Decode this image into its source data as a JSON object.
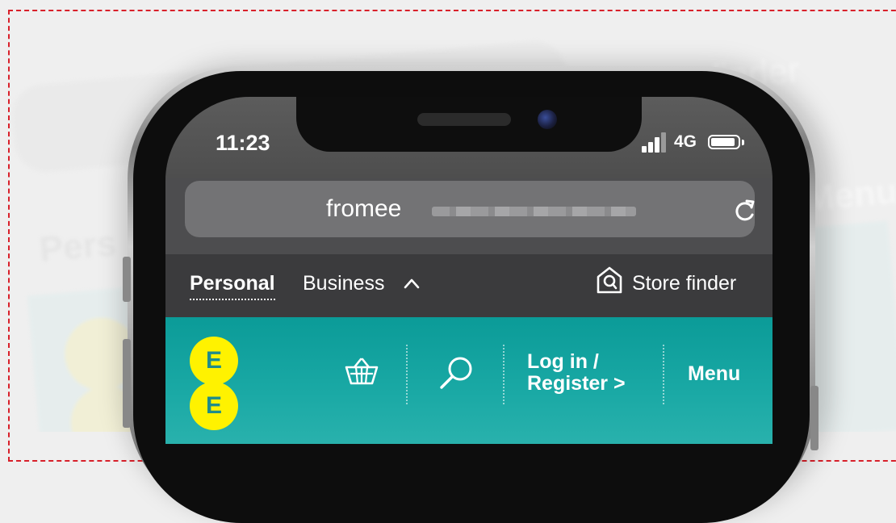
{
  "background": {
    "echo_url": "fromee",
    "echo_store": "Store finder",
    "echo_personal": "Pers",
    "echo_menu": "Menu"
  },
  "status_bar": {
    "time": "11:23",
    "network": "4G",
    "battery_level": 0.9
  },
  "browser": {
    "url_visible": "fromee",
    "reload_icon": "reload-icon"
  },
  "segment_bar": {
    "personal": "Personal",
    "business": "Business",
    "business_chevron_icon": "chevron-up-icon",
    "store_icon": "store-location-icon",
    "store_finder": "Store finder"
  },
  "ee_header": {
    "logo_letters": [
      "E",
      "E"
    ],
    "basket_icon": "basket-icon",
    "search_icon": "search-icon",
    "login_line1": "Log in /",
    "login_line2": "Register >",
    "menu": "Menu"
  },
  "colors": {
    "accent_frame": "#d8202a",
    "ee_teal": "#0b9b98",
    "ee_yellow": "#fff200"
  }
}
